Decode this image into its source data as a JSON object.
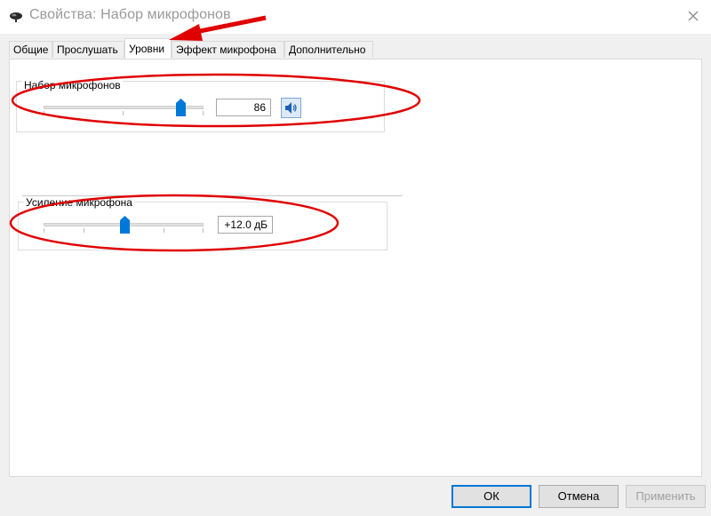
{
  "window": {
    "title": "Свойства: Набор микрофонов"
  },
  "tabs": [
    {
      "label": "Общие"
    },
    {
      "label": "Прослушать"
    },
    {
      "label": "Уровни"
    },
    {
      "label": "Эффект микрофона"
    },
    {
      "label": "Дополнительно"
    }
  ],
  "levels": {
    "mic_array": {
      "label": "Набор микрофонов",
      "value": "86",
      "level_percent": 86
    },
    "mic_boost": {
      "label": "Усиление микрофона",
      "value": "+12.0 дБ",
      "level_fraction": 0.4
    }
  },
  "buttons": {
    "ok": "ОК",
    "cancel": "Отмена",
    "apply": "Применить"
  },
  "colors": {
    "thumb": "#0078d7",
    "annotation_red": "#e00000",
    "title_text": "#9a9a9a"
  },
  "icons": {
    "app": "microphone-icon",
    "close": "close-icon",
    "speaker": "speaker-volume-icon"
  }
}
